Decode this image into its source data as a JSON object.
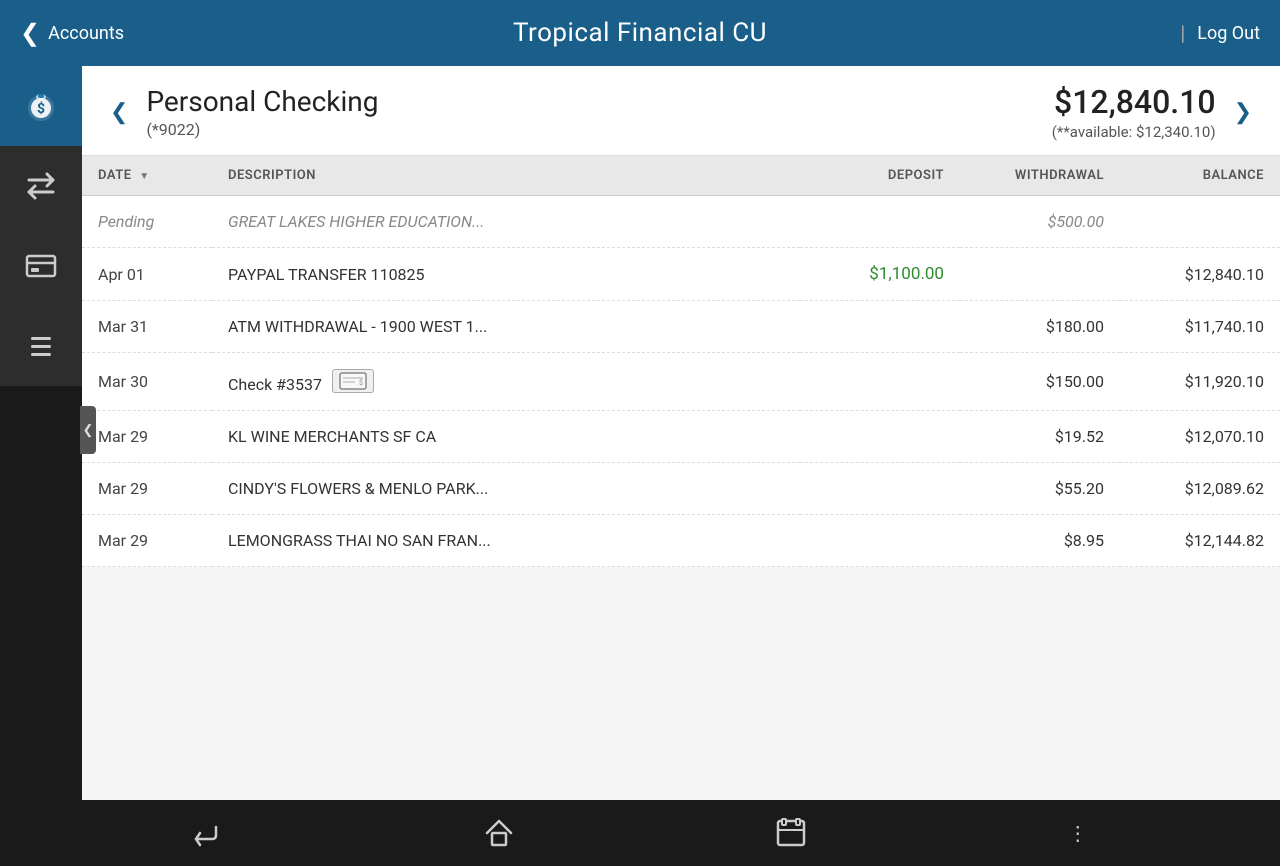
{
  "app": {
    "title": "Tropical Financial CU"
  },
  "header": {
    "back_label": "Accounts",
    "logout_label": "Log Out"
  },
  "account": {
    "name": "Personal Checking",
    "number": "(*9022)",
    "balance": "$12,840.10",
    "available": "(**available: $12,340.10)"
  },
  "table": {
    "columns": {
      "date": "DATE",
      "description": "DESCRIPTION",
      "deposit": "DEPOSIT",
      "withdrawal": "WITHDRAWAL",
      "balance": "BALANCE"
    },
    "rows": [
      {
        "date": "Pending",
        "description": "GREAT LAKES HIGHER EDUCATION...",
        "deposit": "",
        "withdrawal": "$500.00",
        "balance": "",
        "pending": true,
        "has_check": false
      },
      {
        "date": "Apr 01",
        "description": "PAYPAL TRANSFER 110825",
        "deposit": "$1,100.00",
        "withdrawal": "",
        "balance": "$12,840.10",
        "pending": false,
        "has_check": false
      },
      {
        "date": "Mar 31",
        "description": "ATM WITHDRAWAL - 1900 WEST 1...",
        "deposit": "",
        "withdrawal": "$180.00",
        "balance": "$11,740.10",
        "pending": false,
        "has_check": false
      },
      {
        "date": "Mar 30",
        "description": "Check #3537",
        "deposit": "",
        "withdrawal": "$150.00",
        "balance": "$11,920.10",
        "pending": false,
        "has_check": true
      },
      {
        "date": "Mar 29",
        "description": "KL WINE MERCHANTS SF CA",
        "deposit": "",
        "withdrawal": "$19.52",
        "balance": "$12,070.10",
        "pending": false,
        "has_check": false
      },
      {
        "date": "Mar 29",
        "description": "CINDY'S FLOWERS & MENLO PARK...",
        "deposit": "",
        "withdrawal": "$55.20",
        "balance": "$12,089.62",
        "pending": false,
        "has_check": false
      },
      {
        "date": "Mar 29",
        "description": "LEMONGRASS THAI NO SAN FRAN...",
        "deposit": "",
        "withdrawal": "$8.95",
        "balance": "$12,144.82",
        "pending": false,
        "has_check": false
      }
    ]
  },
  "sidebar": {
    "items": [
      {
        "id": "accounts",
        "icon": "money-bag",
        "active": true
      },
      {
        "id": "transfer",
        "icon": "transfer",
        "active": false
      },
      {
        "id": "pay",
        "icon": "pay",
        "active": false
      },
      {
        "id": "more",
        "icon": "more",
        "active": false
      }
    ]
  },
  "bottom_nav": {
    "back_icon": "back",
    "home_icon": "home",
    "recents_icon": "recents",
    "menu_icon": "menu-dots"
  }
}
